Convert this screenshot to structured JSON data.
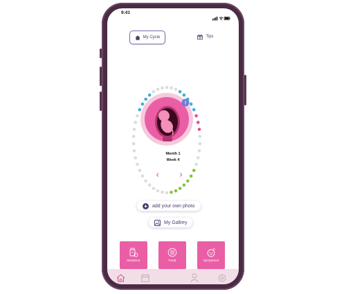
{
  "status_bar": {
    "time": "9:41"
  },
  "tabs": [
    {
      "label": "My Cycle",
      "icon": "home-icon",
      "active": true
    },
    {
      "label": "Tips",
      "icon": "gift-icon",
      "active": false
    }
  ],
  "tracker": {
    "month_label": "Month 1",
    "week_label": "Week 4",
    "badge": "!"
  },
  "actions": {
    "add_photo_label": "add your own photo",
    "gallery_label": "My Gallrey"
  },
  "categories": [
    {
      "label": "Medicine",
      "icon": "medicine-icon"
    },
    {
      "label": "Food",
      "icon": "food-icon"
    },
    {
      "label": "Symptoms",
      "icon": "symptoms-icon"
    }
  ],
  "bottom_nav": [
    {
      "icon": "home-icon",
      "active": true
    },
    {
      "icon": "calendar-icon",
      "active": false
    },
    {
      "icon": "profile-icon",
      "active": false
    },
    {
      "icon": "settings-icon",
      "active": false
    }
  ],
  "colors": {
    "accent_pink": "#ea5ea6",
    "dot_blue": "#3eaed8",
    "dot_green": "#86c440",
    "dot_pink": "#e24c94",
    "dot_gray": "#dcdcdc",
    "nav_bg": "#f2dee6"
  }
}
